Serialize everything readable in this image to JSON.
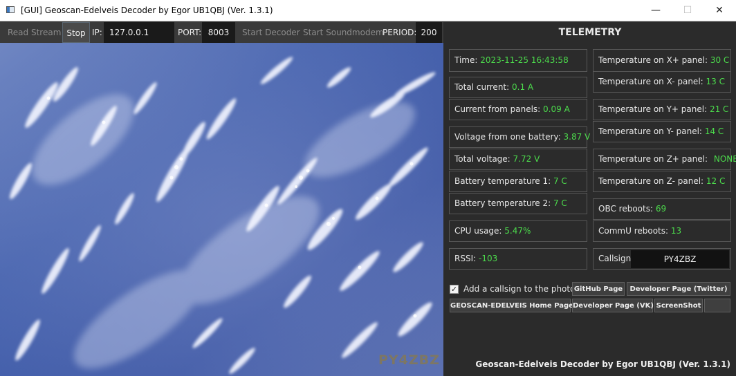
{
  "window": {
    "title": "[GUI] Geoscan-Edelveis Decoder by Egor UB1QBJ (Ver. 1.3.1)",
    "minimize": "—",
    "maximize": "☐",
    "close": "✕"
  },
  "toolbar": {
    "read_stream": "Read Stream",
    "stop": "Stop",
    "ip_label": "IP:",
    "ip_value": "127.0.0.1",
    "port_label": "PORT:",
    "port_value": "8003",
    "start_decoder": "Start Decoder",
    "start_soundmodem": "Start Soundmodem",
    "period_label": "PERIOD:",
    "period_value": "200"
  },
  "photo": {
    "watermark": "PY4ZBZ"
  },
  "telemetry": {
    "title": "TELEMETRY",
    "time": {
      "label": "Time:",
      "value": "2023-11-25 16:43:58"
    },
    "total_current": {
      "label": "Total current:",
      "value": "0.1 A"
    },
    "current_panels": {
      "label": "Current from panels:",
      "value": "0.09 A"
    },
    "voltage_battery": {
      "label": "Voltage from one battery:",
      "value": "3.87 V"
    },
    "total_voltage": {
      "label": "Total voltage:",
      "value": "7.72 V"
    },
    "battery_temp1": {
      "label": "Battery temperature 1:",
      "value": "7 C"
    },
    "battery_temp2": {
      "label": "Battery temperature 2:",
      "value": "7 C"
    },
    "cpu_usage": {
      "label": "CPU usage:",
      "value": "5.47%"
    },
    "rssi": {
      "label": "RSSI:",
      "value": "-103"
    },
    "temp_xp": {
      "label": "Temperature on X+ panel:",
      "value": "30 C"
    },
    "temp_xm": {
      "label": "Temperature on X- panel:",
      "value": "13 C"
    },
    "temp_yp": {
      "label": "Temperature on Y+ panel:",
      "value": "21 C"
    },
    "temp_ym": {
      "label": "Temperature on Y- panel:",
      "value": "14 C"
    },
    "temp_zp": {
      "label": "Temperature on Z+ panel:",
      "value": "NONE"
    },
    "temp_zm": {
      "label": "Temperature on Z- panel:",
      "value": "12 C"
    },
    "obc_reboots": {
      "label": "OBC reboots:",
      "value": "69"
    },
    "commu_reboots": {
      "label": "CommU reboots:",
      "value": "13"
    },
    "callsign": {
      "label": "Callsign:",
      "value": "PY4ZBZ"
    }
  },
  "options": {
    "add_callsign_label": "Add a callsign to the photo?",
    "add_callsign_checked": "✓"
  },
  "buttons": {
    "github": "GitHub Page",
    "dev_twitter": "Developer Page (Twitter)",
    "home": "GEOSCAN-EDELVEIS Home Page",
    "dev_vk": "Developer Page (VK)",
    "screenshot": "ScreenShot",
    "extra": ""
  },
  "footer": "Geoscan-Edelveis Decoder by Egor UB1QBJ (Ver. 1.3.1)",
  "colors": {
    "value_green": "#4cdc4c",
    "panel_bg": "#2b2b2b",
    "field_bg": "#1a1a1a"
  }
}
